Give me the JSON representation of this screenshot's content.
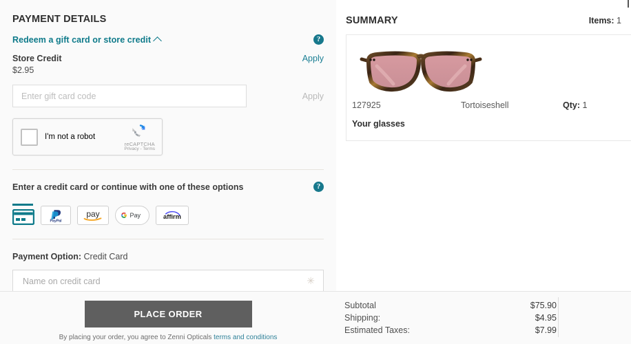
{
  "payment": {
    "section_title": "PAYMENT DETAILS",
    "redeem_link": "Redeem a gift card or store credit",
    "redeem_chevron_icon": "chevron-up-icon",
    "help_icon": "question-mark-circle-icon",
    "help_glyph": "?",
    "store_credit_label": "Store Credit",
    "store_credit_amount": "$2.95",
    "store_credit_apply": "Apply",
    "giftcard_placeholder": "Enter gift card code",
    "giftcard_value": "",
    "giftcard_apply": "Apply",
    "recaptcha": {
      "label": "I'm not a robot",
      "brand": "reCAPTCHA",
      "terms": "Privacy - Terms",
      "logo_icon": "recaptcha-logo-icon"
    },
    "options_label": "Enter a credit card or continue with one of these options",
    "options_help_icon": "question-mark-circle-icon",
    "methods": [
      {
        "name": "credit-card",
        "label": "Credit Card",
        "selected": true
      },
      {
        "name": "paypal",
        "label": "PayPal",
        "selected": false
      },
      {
        "name": "amazon-pay",
        "label": "pay",
        "selected": false
      },
      {
        "name": "google-pay",
        "label": "G Pay",
        "selected": false
      },
      {
        "name": "affirm",
        "label": "affirm",
        "selected": false
      }
    ],
    "payment_option_label": "Payment Option:",
    "payment_option_value": "Credit Card",
    "name_placeholder": "Name on credit card",
    "name_value": "",
    "required_glyph": "✳"
  },
  "summary": {
    "title": "SUMMARY",
    "items_label": "Items:",
    "items_count": "1",
    "product": {
      "image_icon": "eyeglasses-tortoiseshell-rose-lens-image",
      "sku": "127925",
      "color": "Tortoiseshell",
      "qty_label": "Qty:",
      "qty_value": "1",
      "name": "Your glasses"
    }
  },
  "bottom": {
    "place_order": "PLACE ORDER",
    "terms_prefix": "By placing your order, you agree to Zenni Opticals",
    "terms_link": "terms and conditions",
    "totals": [
      {
        "label": "Subtotal",
        "value": "$75.90"
      },
      {
        "label": "Shipping:",
        "value": "$4.95"
      },
      {
        "label": "Estimated Taxes:",
        "value": "$7.99"
      }
    ]
  },
  "colors": {
    "teal": "#0e7a8a",
    "link": "#1b7f94",
    "button": "#5f5f5f",
    "panel_bg": "#fafafa"
  }
}
